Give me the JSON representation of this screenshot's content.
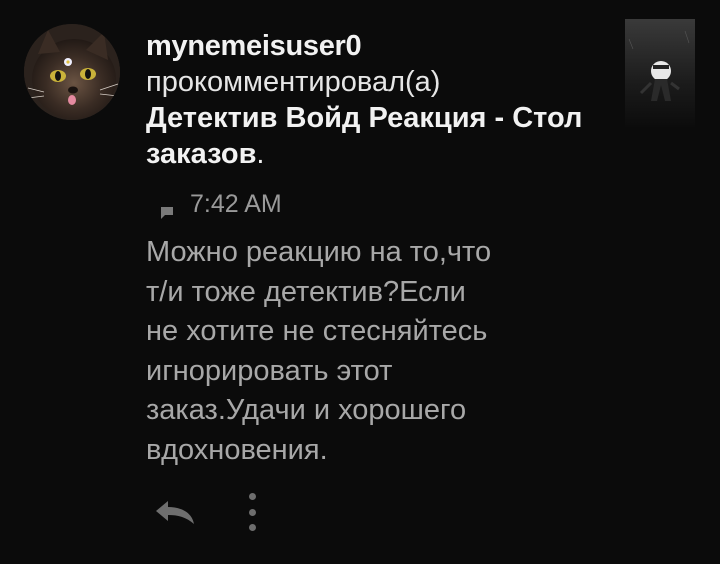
{
  "notification": {
    "username": "mynemeisuser0",
    "action_text": "прокомментировал(а)",
    "post_title": "Детектив Войд Реакция - Стол заказов",
    "post_title_suffix": ".",
    "time": "7:42 AM",
    "comment_lines": [
      "Можно реакцию на то,что",
      "т/и тоже детектив?Если",
      "не хотите не стесняйтесь",
      "игнорировать этот",
      "заказ.Удачи и хорошего",
      "вдохновения."
    ]
  },
  "icons": {
    "comment": "comment-icon",
    "reply": "reply-icon",
    "more": "more-vertical-icon"
  },
  "colors": {
    "background": "#0b0b0b",
    "primary_text": "#f2f2f2",
    "secondary_text": "#a8a8a8",
    "meta_text": "#9a9a9a",
    "icon_gray": "#6e6e6e"
  }
}
